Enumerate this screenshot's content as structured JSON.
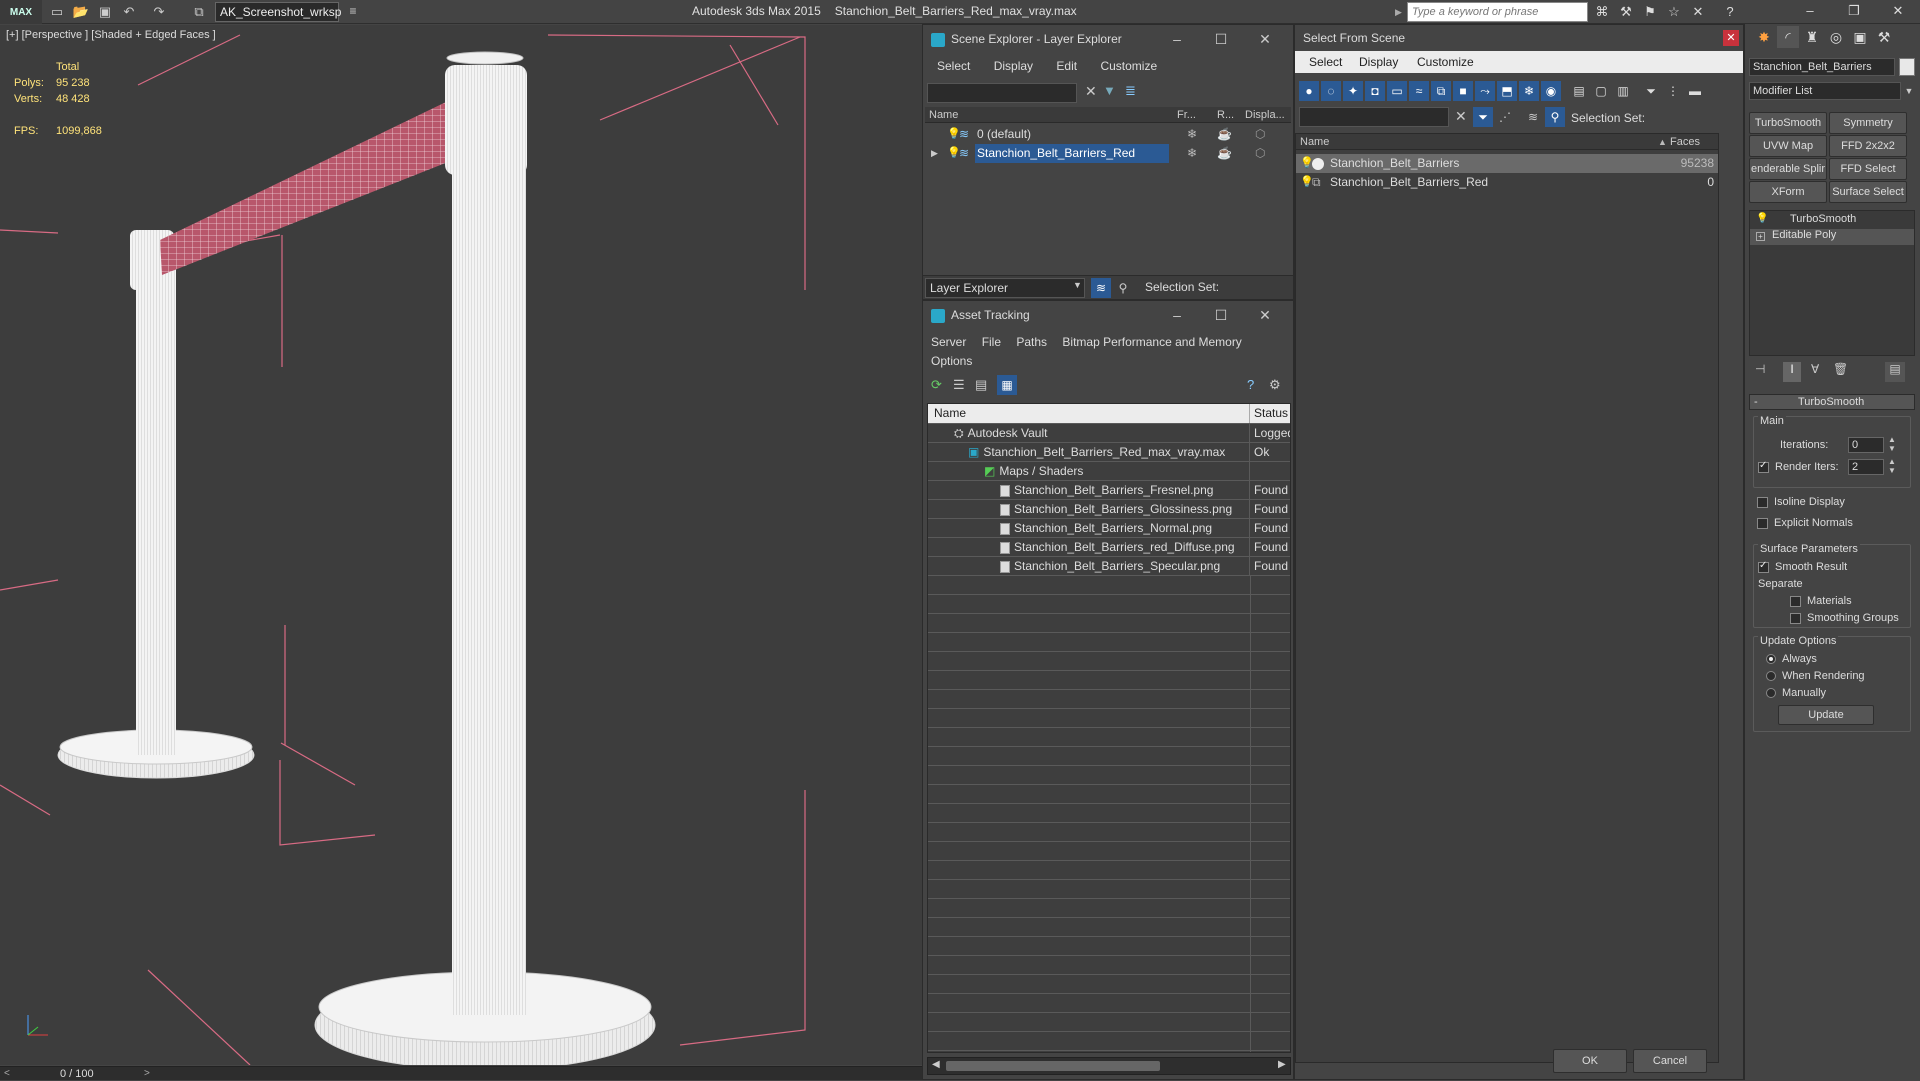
{
  "app": {
    "logo": "MAX",
    "workspace": "AK_Screenshot_wrksp",
    "title_app": "Autodesk 3ds Max  2015",
    "title_file": "Stanchion_Belt_Barriers_Red_max_vray.max",
    "search_placeholder": "Type a keyword or phrase"
  },
  "viewport": {
    "label": "[+] [Perspective ] [Shaded + Edged Faces ]",
    "stats_total": "Total",
    "polys_label": "Polys:",
    "polys_value": "95 238",
    "verts_label": "Verts:",
    "verts_value": "48 428",
    "fps_label": "FPS:",
    "fps_value": "1099,868",
    "timeline": "0 / 100",
    "timeline_prev": "<",
    "timeline_next": ">"
  },
  "scene_explorer": {
    "title": "Scene Explorer - Layer Explorer",
    "menu": [
      "Select",
      "Display",
      "Edit",
      "Customize"
    ],
    "columns": [
      "Name",
      "Fr...",
      "R...",
      "Displa..."
    ],
    "rows": [
      {
        "name": "0 (default)"
      },
      {
        "name": "Stanchion_Belt_Barriers_Red"
      }
    ],
    "footer_dropdown": "Layer Explorer",
    "selection_set": "Selection Set:"
  },
  "asset_tracking": {
    "title": "Asset Tracking",
    "menu": [
      "Server",
      "File",
      "Paths",
      "Bitmap Performance and Memory"
    ],
    "menu2": "Options",
    "columns": [
      "Name",
      "Status"
    ],
    "rows": [
      {
        "name": "Autodesk Vault",
        "status": "Logged"
      },
      {
        "name": "Stanchion_Belt_Barriers_Red_max_vray.max",
        "status": "Ok"
      },
      {
        "name": "Maps / Shaders",
        "status": ""
      },
      {
        "name": "Stanchion_Belt_Barriers_Fresnel.png",
        "status": "Found"
      },
      {
        "name": "Stanchion_Belt_Barriers_Glossiness.png",
        "status": "Found"
      },
      {
        "name": "Stanchion_Belt_Barriers_Normal.png",
        "status": "Found"
      },
      {
        "name": "Stanchion_Belt_Barriers_red_Diffuse.png",
        "status": "Found"
      },
      {
        "name": "Stanchion_Belt_Barriers_Specular.png",
        "status": "Found"
      }
    ]
  },
  "select_from_scene": {
    "title": "Select From Scene",
    "menu": [
      "Select",
      "Display",
      "Customize"
    ],
    "selection_set": "Selection Set:",
    "columns": [
      "Name",
      "Faces"
    ],
    "rows": [
      {
        "name": "Stanchion_Belt_Barriers",
        "faces": "95238"
      },
      {
        "name": "Stanchion_Belt_Barriers_Red",
        "faces": "0"
      }
    ],
    "ok": "OK",
    "cancel": "Cancel"
  },
  "command_panel": {
    "object_name": "Stanchion_Belt_Barriers",
    "modifier_list": "Modifier List",
    "buttons": [
      "TurboSmooth",
      "Symmetry",
      "UVW Map",
      "FFD 2x2x2",
      "enderable Splir",
      "FFD Select",
      "XForm",
      "Surface Select"
    ],
    "stack": [
      "TurboSmooth",
      "Editable Poly"
    ],
    "rollout_title": "TurboSmooth",
    "main": "Main",
    "iterations_label": "Iterations:",
    "iterations_value": "0",
    "render_iters_label": "Render Iters:",
    "render_iters_value": "2",
    "isoline": "Isoline Display",
    "explicit": "Explicit Normals",
    "surface_params": "Surface Parameters",
    "smooth_result": "Smooth Result",
    "separate": "Separate",
    "materials": "Materials",
    "smoothing_groups": "Smoothing Groups",
    "update_options": "Update Options",
    "always": "Always",
    "when_rendering": "When Rendering",
    "manually": "Manually",
    "update": "Update"
  }
}
